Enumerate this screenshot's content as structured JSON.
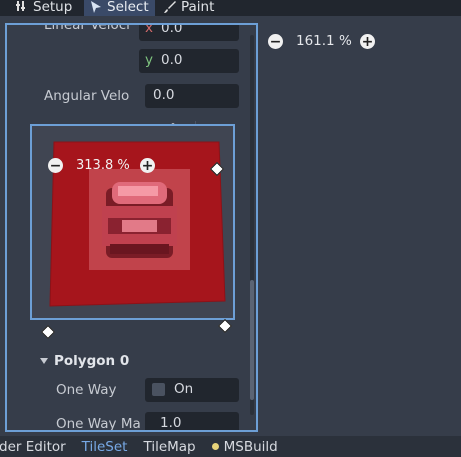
{
  "toolbar": {
    "setup_label": "Setup",
    "select_label": "Select",
    "paint_label": "Paint",
    "right_zoom": {
      "minus": "−",
      "value": "161.1 %",
      "plus": "+"
    }
  },
  "inspector": {
    "linear_velocity_label": "Linear Veloci",
    "linear_x_axis": "x",
    "linear_x_value": "0.0",
    "linear_y_axis": "y",
    "linear_y_value": "0.0",
    "angular_velocity_label": "Angular Velo",
    "angular_velocity_value": "0.0",
    "tile_zoom": {
      "minus": "−",
      "value": "313.8 %",
      "plus": "+"
    },
    "polygon_section_label": "Polygon 0",
    "one_way_label": "One Way",
    "one_way_checkbox_label": "On",
    "one_way_checked": false,
    "one_way_margin_label": "One Way Ma",
    "one_way_margin_value": "1.0"
  },
  "colors": {
    "accent": "#6d9fd6",
    "polygon_fill": "#a6151c",
    "background": "#363d4a"
  },
  "bottom_bar": {
    "items": [
      "der Editor",
      "TileSet",
      "TileMap",
      "MSBuild"
    ],
    "active_index": 1,
    "msbuild_dot_color": "#e7d37a"
  }
}
